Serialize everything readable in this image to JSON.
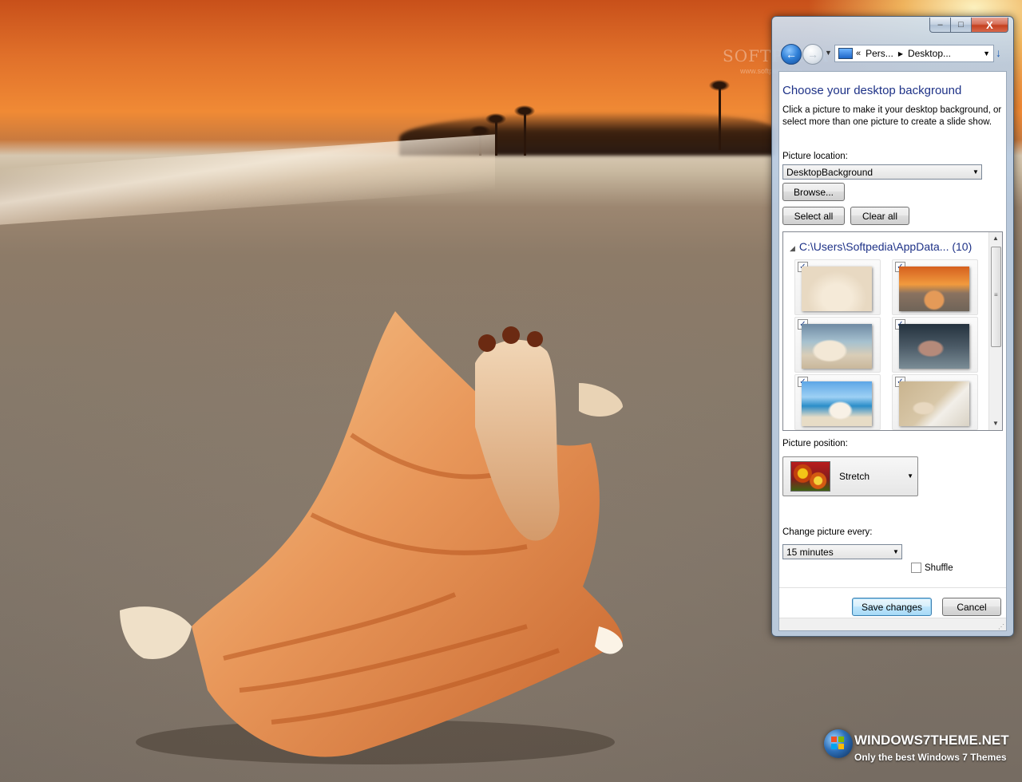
{
  "window": {
    "caption_buttons": {
      "minimize": "–",
      "maximize": "□",
      "close": "X"
    },
    "address": {
      "breadcrumb_overflow": "«",
      "crumbs": [
        "Pers...",
        "Desktop..."
      ]
    }
  },
  "page": {
    "heading": "Choose your desktop background",
    "description": "Click a picture to make it your desktop background, or select more than one picture to create a slide show.",
    "picture_location_label": "Picture location:",
    "picture_location_value": "DesktopBackground",
    "browse_label": "Browse...",
    "select_all_label": "Select all",
    "clear_all_label": "Clear all",
    "gallery": {
      "group_title": "C:\\Users\\Softpedia\\AppData... (10)",
      "tiles": [
        {
          "checked": true,
          "thumb": "shells-on-white-sand"
        },
        {
          "checked": true,
          "thumb": "conch-at-sunset"
        },
        {
          "checked": true,
          "thumb": "shell-at-shore"
        },
        {
          "checked": true,
          "thumb": "pebbles-and-shells"
        },
        {
          "checked": true,
          "thumb": "shell-on-beach-blue-sky"
        },
        {
          "checked": true,
          "thumb": "shell-in-surf"
        }
      ]
    },
    "picture_position_label": "Picture position:",
    "picture_position_value": "Stretch",
    "change_every_label": "Change picture every:",
    "change_every_value": "15 minutes",
    "shuffle_label": "Shuffle",
    "shuffle_checked": false,
    "save_label": "Save changes",
    "cancel_label": "Cancel"
  },
  "desktop": {
    "watermark": "SOFTPEDIA",
    "watermark_url": "www.softpedia.com",
    "brand_title": "WINDOWS7THEME.NET",
    "brand_tagline": "Only the best Windows 7 Themes"
  },
  "colors": {
    "heading_blue": "#1e3287",
    "close_red": "#c4401f",
    "default_button_border": "#3c7fb1"
  }
}
